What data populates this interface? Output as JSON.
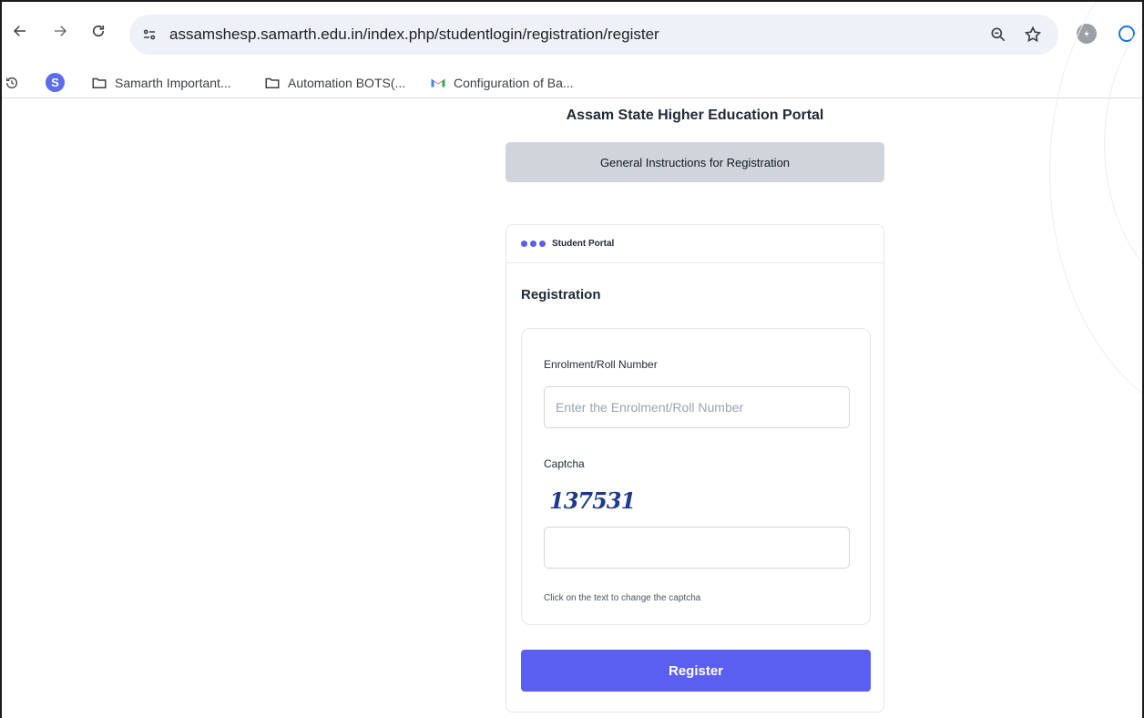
{
  "browser": {
    "url": "assamshesp.samarth.edu.in/index.php/studentlogin/registration/register",
    "bookmarks": [
      {
        "label": "S"
      },
      {
        "label": "Samarth Important..."
      },
      {
        "label": "Automation BOTS(..."
      },
      {
        "label": "Configuration of Ba..."
      }
    ]
  },
  "page": {
    "site_title": "Assam State Higher Education Portal",
    "instructions_label": "General Instructions for Registration",
    "card": {
      "portal_label": "Student Portal",
      "heading": "Registration",
      "roll_label": "Enrolment/Roll Number",
      "roll_placeholder": "Enter the Enrolment/Roll Number",
      "captcha_label": "Captcha",
      "captcha_text": "137531",
      "captcha_value": "",
      "captcha_hint": "Click on the text to change the captcha",
      "register_label": "Register"
    }
  },
  "colors": {
    "accent": "#5b5ff1",
    "instructions_bg": "#d1d5db",
    "captcha_text": "#1e3a8a"
  }
}
